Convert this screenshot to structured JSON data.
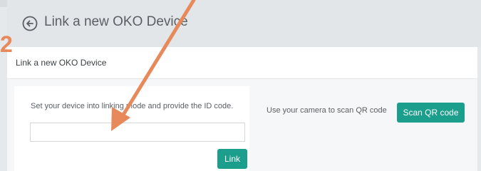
{
  "header": {
    "title": "Link a new OKO Device",
    "back_icon": "arrow-left-circle-icon"
  },
  "card": {
    "title": "Link a new OKO Device",
    "link_section": {
      "instruction": "Set your device into linking mode and provide the ID code.",
      "id_input_value": "",
      "link_button": "Link"
    },
    "scan_section": {
      "instruction": "Use your camera to scan QR code",
      "scan_button": "Scan QR code"
    }
  },
  "annotation": {
    "step_number": "2",
    "color": "#e8895c"
  },
  "colors": {
    "accent": "#1b9e8c",
    "header_bg": "#e3e6e9"
  }
}
